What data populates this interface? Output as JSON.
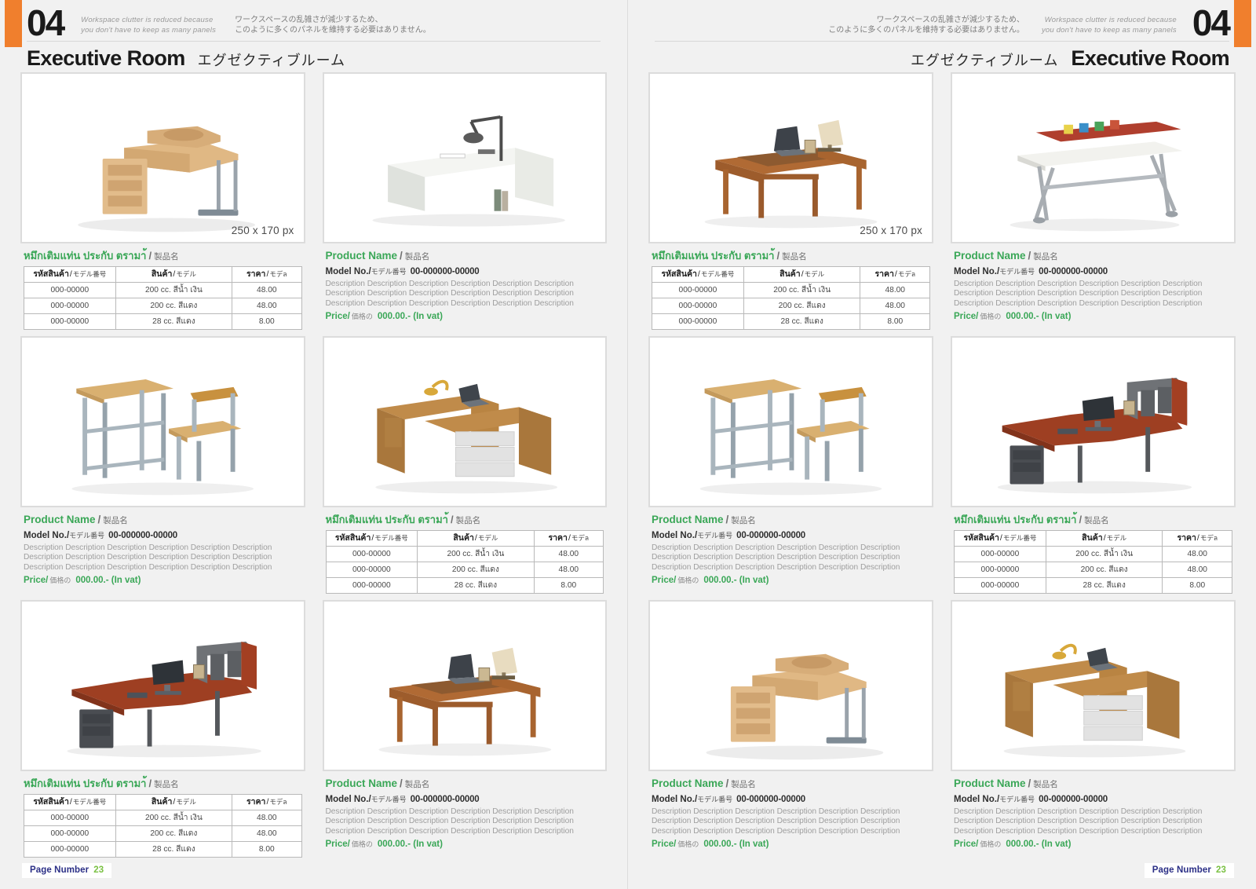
{
  "spread": {
    "chapter_number": "04",
    "tagline_en": "Workspace clutter is reduced because\nyou don't have to keep as many panels",
    "tagline_jp": "ワークスペースの乱雑さが減少するため、\nこのように多くのパネルを維持する必要はありません。",
    "room_title_en": "Executive Room",
    "room_title_jp": "エグゼクティブルーム",
    "accent_orange": "#f07f2d",
    "accent_green": "#3aa757",
    "accent_navy": "#2b2f86",
    "page_number_label": "Page Number",
    "page_number_value": "23",
    "image_placeholder_label": "250 x 170 px"
  },
  "labels": {
    "product_name_en": "Product Name",
    "product_name_jp": "製品名",
    "product_name_th": "หมึกเติมแท่น ประกับ ตรามา้",
    "model_en": "Model No.",
    "model_jp": "モデル番号",
    "model_value": "00-000000-00000",
    "description": "Description Description Description Description Description Description Description Description Description Description Description Description Description Description Description Description Description Description",
    "price_en": "Price",
    "price_jp": "価格の",
    "price_value": "000.00.- (In vat)",
    "separator": "/"
  },
  "table": {
    "headers": [
      {
        "th": "รหัสสินค้า",
        "jp": "モデル番号"
      },
      {
        "th": "สินค้า",
        "jp": "モデル"
      },
      {
        "th": "ราคา",
        "jp": "モデล"
      }
    ],
    "rows": [
      {
        "code": "000-00000",
        "item": "200 cc. สีน้ำ เงิน",
        "price": "48.00"
      },
      {
        "code": "000-00000",
        "item": "200 cc. สีแดง",
        "price": "48.00"
      },
      {
        "code": "000-00000",
        "item": "28 cc. สีแดง",
        "price": "8.00"
      }
    ]
  },
  "cells": [
    {
      "id": "l-r1-c1",
      "layout": "table",
      "art": "corner-desk-beech",
      "px_label": true
    },
    {
      "id": "l-r1-c2",
      "layout": "text",
      "art": "modern-white-desk",
      "px_label": false
    },
    {
      "id": "l-r2-c1",
      "layout": "text",
      "art": "school-desk-chair",
      "px_label": false
    },
    {
      "id": "l-r2-c2",
      "layout": "table",
      "art": "wood-desk-drawers",
      "px_label": false
    },
    {
      "id": "l-r3-c1",
      "layout": "table",
      "art": "exec-workstation",
      "px_label": false
    },
    {
      "id": "l-r3-c2",
      "layout": "text",
      "art": "classic-wood-desk",
      "px_label": false
    },
    {
      "id": "r-r1-c1",
      "layout": "table",
      "art": "classic-wood-desk",
      "px_label": true
    },
    {
      "id": "r-r1-c2",
      "layout": "text",
      "art": "drafting-table",
      "px_label": false
    },
    {
      "id": "r-r2-c1",
      "layout": "text",
      "art": "school-desk-chair",
      "px_label": false
    },
    {
      "id": "r-r2-c2",
      "layout": "table",
      "art": "exec-workstation",
      "px_label": false
    },
    {
      "id": "r-r3-c1",
      "layout": "text",
      "art": "corner-desk-beech",
      "px_label": false
    },
    {
      "id": "r-r3-c2",
      "layout": "text",
      "art": "wood-desk-drawers",
      "px_label": false
    }
  ]
}
